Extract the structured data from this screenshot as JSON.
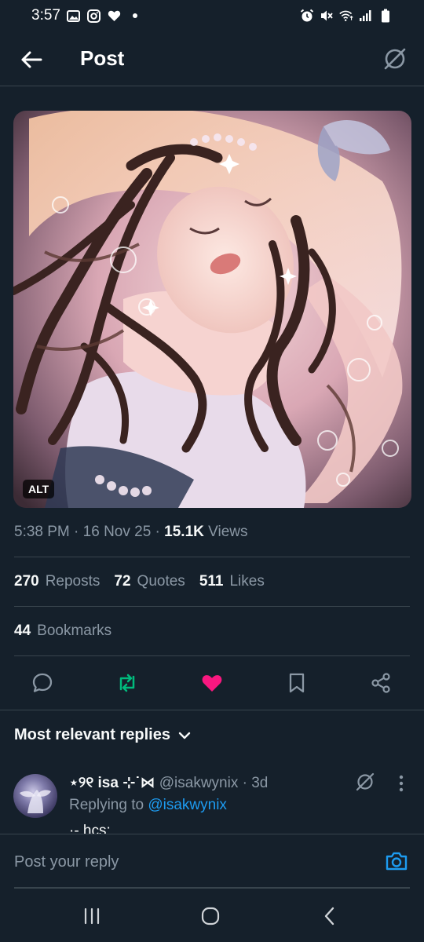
{
  "status_bar": {
    "time": "3:57",
    "left_icons": [
      "gallery-icon",
      "instagram-icon",
      "heart-icon",
      "dot-icon"
    ],
    "right_icons": [
      "alarm-icon",
      "mute-icon",
      "wifi-icon",
      "signal-icon",
      "battery-icon"
    ]
  },
  "header": {
    "title": "Post",
    "back_icon": "arrow-left-icon",
    "right_icon": "grok-icon"
  },
  "media": {
    "alt_badge": "ALT"
  },
  "meta": {
    "time": "5:38 PM",
    "sep1": " · ",
    "date": "16 Nov 25",
    "sep2": " · ",
    "views_count": "15.1K",
    "views_label": " Views"
  },
  "stats": {
    "reposts_count": "270",
    "reposts_label": "Reposts",
    "quotes_count": "72",
    "quotes_label": "Quotes",
    "likes_count": "511",
    "likes_label": "Likes",
    "bookmarks_count": "44",
    "bookmarks_label": "Bookmarks"
  },
  "actions": {
    "reply_icon": "reply-icon",
    "repost_icon": "repost-icon",
    "like_icon": "heart-filled-icon",
    "bookmark_icon": "bookmark-icon",
    "share_icon": "share-icon",
    "repost_color": "#00ba7c",
    "like_color": "#f91880"
  },
  "replies": {
    "header": "Most relevant replies",
    "first": {
      "display_name": "⋆୨୧ isa ⊹˙⋈",
      "handle": " @isakwynix",
      "time": " · 3d",
      "replying_prefix": "Replying to ",
      "replying_handle": "@isakwynix",
      "text": "·- hcs:"
    }
  },
  "compose": {
    "placeholder": "Post your reply",
    "camera_icon": "camera-icon"
  },
  "nav": {
    "recents_icon": "recents-icon",
    "home_icon": "home-icon",
    "back_icon": "back-chevron-icon"
  },
  "colors": {
    "background": "#15202b",
    "accent": "#1d9bf0",
    "muted": "#8b98a5",
    "divider": "#38444d"
  }
}
